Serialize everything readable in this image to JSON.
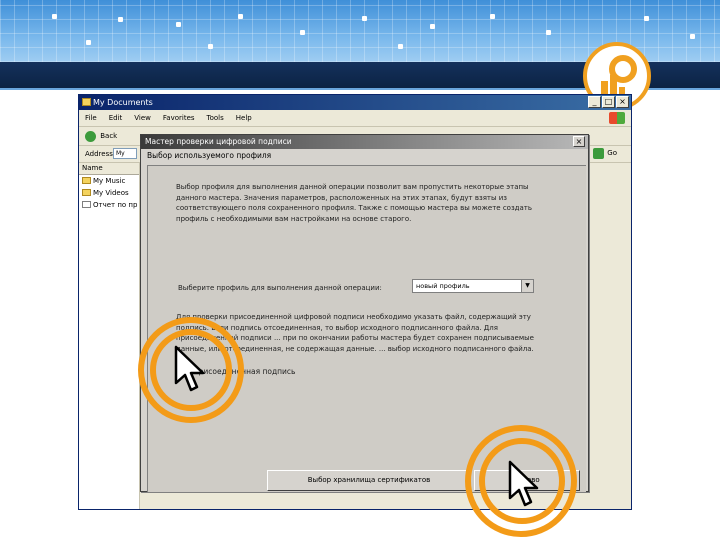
{
  "explorer": {
    "title": "My Documents",
    "menu": [
      "File",
      "Edit",
      "View",
      "Favorites",
      "Tools",
      "Help"
    ],
    "back_label": "Back",
    "address_label": "Address",
    "address_value": "My",
    "go_label": "Go",
    "list_header": "Name",
    "list_items": [
      "My Music",
      "My Videos",
      "Отчет по пр"
    ]
  },
  "wizard": {
    "title": "Мастер проверки цифровой подписи",
    "step_title": "Выбор используемого профиля",
    "description": "Выбор профиля для выполнения данной операции позволит вам пропустить некоторые этапы данного мастера. Значения параметров, расположенных на этих этапах, будут взяты из соответствующего поля сохраненного профиля. Также с помощью мастера вы можете создать профиль с необходимыми вам настройками на основе старого.",
    "profile_label": "Выберите профиль для выполнения данной операции:",
    "profile_value": "новый профиль",
    "note": "Для проверки присоединенной цифровой подписи необходимо указать файл, содержащий эту подпись. Если подпись отсоединенная, то выбор исходного подписанного файла. Для присоединенной подписи ... при по окончании работы мастера будет сохранен подписываемые данные, или отсоединенная, не содержащая данные. ... выбор исходного подписанного файла.",
    "attach_checkbox_label": "Присоединенная подпись",
    "cert_store_button": "Выбор хранилища сертификатов",
    "done_button": "Готово"
  },
  "colors": {
    "ring": "#f39b18",
    "header_blue": "#3f8fd8",
    "band_navy": "#14315c"
  }
}
